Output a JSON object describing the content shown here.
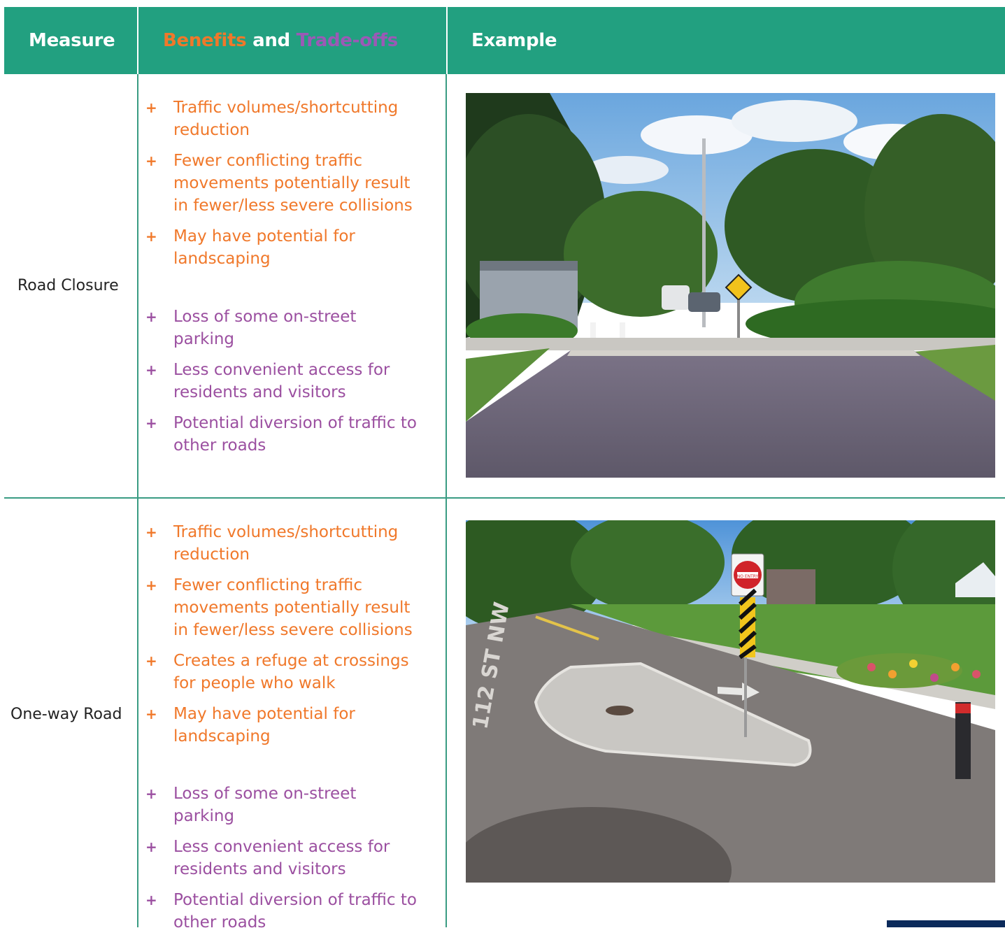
{
  "header": {
    "measure": "Measure",
    "benefits_word": "Benefits",
    "and_word": "and",
    "tradeoffs_word": "Trade-offs",
    "example": "Example"
  },
  "colors": {
    "header_bg": "#22a080",
    "benefit": "#f0782a",
    "tradeoff": "#9b4fa0",
    "rule": "#3a9c83"
  },
  "rows": [
    {
      "measure": "Road Closure",
      "benefits": [
        "Traffic volumes/shortcutting reduction",
        "Fewer conflicting traffic movements potentially result in fewer/less severe collisions",
        "May have potential for landscaping"
      ],
      "tradeoffs": [
        "Loss of some on-street parking",
        "Less convenient access for residents and visitors",
        "Potential diversion of traffic to other roads"
      ]
    },
    {
      "measure": "One-way Road",
      "benefits": [
        "Traffic volumes/shortcutting reduction",
        "Fewer conflicting traffic movements potentially result in fewer/less severe collisions",
        "Creates a refuge at crossings for people who walk",
        "May have potential for landscaping"
      ],
      "tradeoffs": [
        "Loss of some on-street parking",
        "Less convenient access for residents and visitors",
        "Potential diversion of traffic to other roads"
      ],
      "photo_sign_text": "NO ENTRY",
      "photo_street_text": "112 ST NW"
    }
  ],
  "bullet_glyph": "+"
}
